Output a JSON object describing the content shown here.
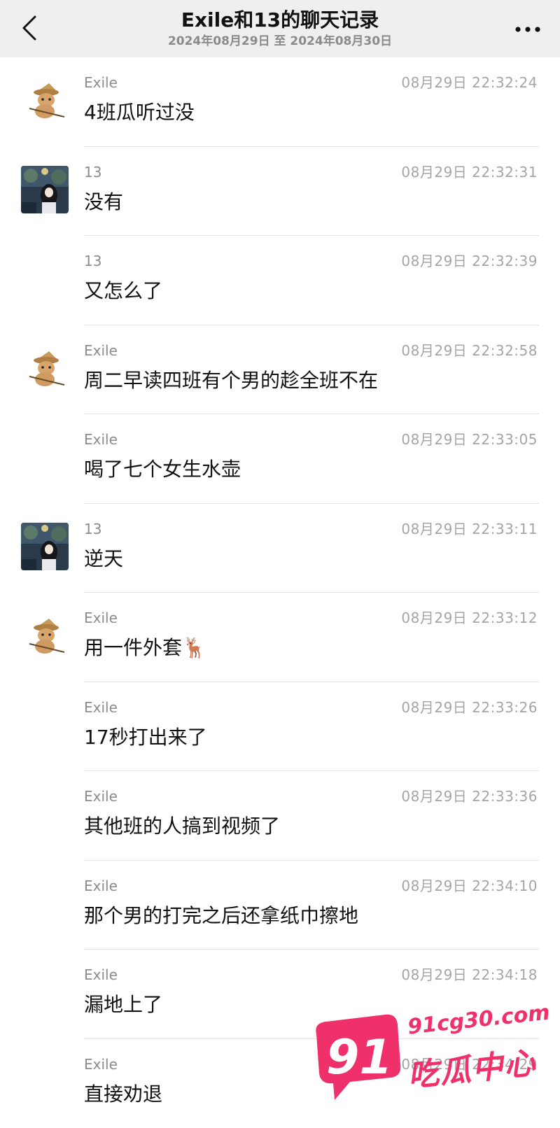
{
  "header": {
    "title": "Exile和13的聊天记录",
    "date_range": "2024年08月29日 至 2024年08月30日"
  },
  "icons": {
    "back": "chevron-left-icon",
    "more": "more-dots-icon",
    "exile_avatar": "straw-hat-dog-avatar",
    "thirteen_avatar": "anime-girl-avatar"
  },
  "messages": [
    {
      "sender": "Exile",
      "time": "08月29日 22:32:24",
      "text": "4班瓜听过没",
      "show_avatar": true
    },
    {
      "sender": "13",
      "time": "08月29日 22:32:31",
      "text": "没有",
      "show_avatar": true
    },
    {
      "sender": "13",
      "time": "08月29日 22:32:39",
      "text": "又怎么了",
      "show_avatar": false
    },
    {
      "sender": "Exile",
      "time": "08月29日 22:32:58",
      "text": "周二早读四班有个男的趁全班不在",
      "show_avatar": true
    },
    {
      "sender": "Exile",
      "time": "08月29日 22:33:05",
      "text": "喝了七个女生水壶",
      "show_avatar": false
    },
    {
      "sender": "13",
      "time": "08月29日 22:33:11",
      "text": "逆天",
      "show_avatar": true
    },
    {
      "sender": "Exile",
      "time": "08月29日 22:33:12",
      "text": "用一件外套🦌",
      "show_avatar": true
    },
    {
      "sender": "Exile",
      "time": "08月29日 22:33:26",
      "text": "17秒打出来了",
      "show_avatar": false
    },
    {
      "sender": "Exile",
      "time": "08月29日 22:33:36",
      "text": "其他班的人搞到视频了",
      "show_avatar": false
    },
    {
      "sender": "Exile",
      "time": "08月29日 22:34:10",
      "text": "那个男的打完之后还拿纸巾擦地",
      "show_avatar": false
    },
    {
      "sender": "Exile",
      "time": "08月29日 22:34:18",
      "text": "漏地上了",
      "show_avatar": false
    },
    {
      "sender": "Exile",
      "time": "08月29日 22:34:29",
      "text": "直接劝退",
      "show_avatar": false
    }
  ],
  "watermark": {
    "number": "91",
    "url": "91cg30.com",
    "name": "吃瓜中心",
    "color": "#f0306a"
  }
}
